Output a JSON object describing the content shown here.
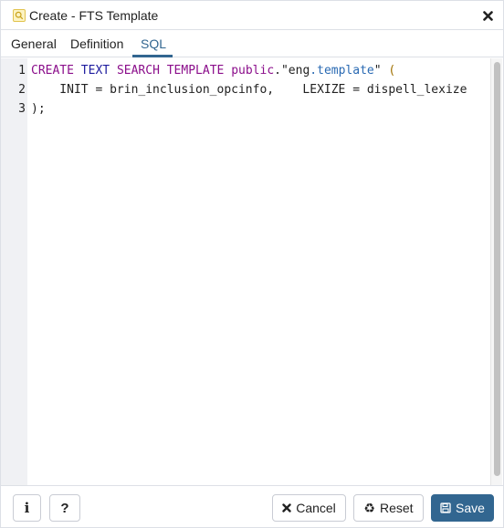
{
  "dialog": {
    "title": "Create - FTS Template",
    "title_icon": "fts-template-icon",
    "close_icon": "close-icon"
  },
  "tabs": [
    {
      "label": "General",
      "active": false
    },
    {
      "label": "Definition",
      "active": false
    },
    {
      "label": "SQL",
      "active": true
    }
  ],
  "editor": {
    "line_numbers": [
      "1",
      "2",
      "3"
    ],
    "lines": [
      {
        "tokens": [
          {
            "text": "CREATE",
            "type": "kw"
          },
          {
            "text": " ",
            "type": "plain"
          },
          {
            "text": "TEXT",
            "type": "kw2"
          },
          {
            "text": " ",
            "type": "plain"
          },
          {
            "text": "SEARCH",
            "type": "kw"
          },
          {
            "text": " ",
            "type": "plain"
          },
          {
            "text": "TEMPLATE",
            "type": "kw"
          },
          {
            "text": " ",
            "type": "plain"
          },
          {
            "text": "public",
            "type": "kw"
          },
          {
            "text": ".\"eng",
            "type": "plain"
          },
          {
            "text": ".template",
            "type": "prop"
          },
          {
            "text": "\" ",
            "type": "plain"
          },
          {
            "text": "(",
            "type": "muted"
          }
        ]
      },
      {
        "tokens": [
          {
            "text": "    INIT = brin_inclusion_opcinfo,    LEXIZE = dispell_lexize",
            "type": "plain"
          }
        ]
      },
      {
        "tokens": [
          {
            "text": ");",
            "type": "plain"
          }
        ]
      }
    ]
  },
  "footer": {
    "info_icon_label": "i",
    "help_icon_label": "?",
    "cancel_label": "Cancel",
    "reset_label": "Reset",
    "save_label": "Save"
  },
  "colors": {
    "accent": "#326690",
    "keyword": "#8b0e8b",
    "keyword_alt": "#1d1b9e",
    "property": "#2a6ab3"
  }
}
